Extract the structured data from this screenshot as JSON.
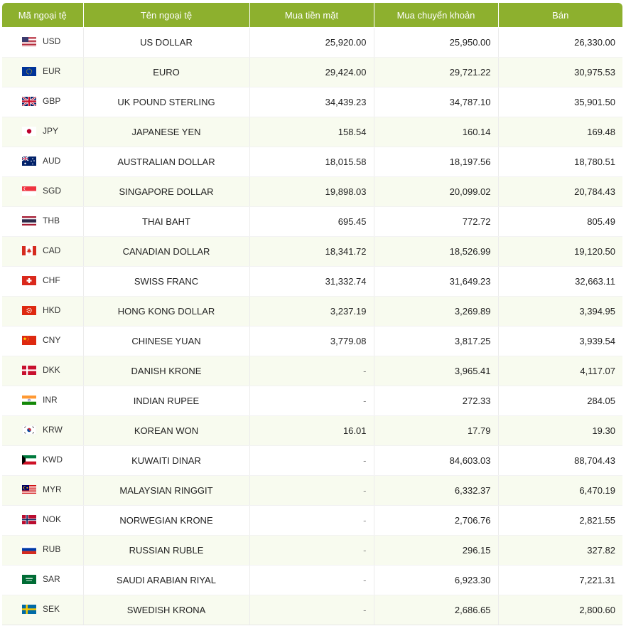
{
  "table": {
    "headers": {
      "code": "Mã ngoại tệ",
      "name": "Tên ngoại tệ",
      "cash_buy": "Mua tiền mặt",
      "transfer_buy": "Mua chuyển khoản",
      "sell": "Bán"
    },
    "rows": [
      {
        "code": "USD",
        "name": "US DOLLAR",
        "cash_buy": "25,920.00",
        "transfer_buy": "25,950.00",
        "sell": "26,330.00",
        "flag": "us-flag-icon"
      },
      {
        "code": "EUR",
        "name": "EURO",
        "cash_buy": "29,424.00",
        "transfer_buy": "29,721.22",
        "sell": "30,975.53",
        "flag": "eu-flag-icon"
      },
      {
        "code": "GBP",
        "name": "UK POUND STERLING",
        "cash_buy": "34,439.23",
        "transfer_buy": "34,787.10",
        "sell": "35,901.50",
        "flag": "uk-flag-icon"
      },
      {
        "code": "JPY",
        "name": "JAPANESE YEN",
        "cash_buy": "158.54",
        "transfer_buy": "160.14",
        "sell": "169.48",
        "flag": "japan-flag-icon"
      },
      {
        "code": "AUD",
        "name": "AUSTRALIAN DOLLAR",
        "cash_buy": "18,015.58",
        "transfer_buy": "18,197.56",
        "sell": "18,780.51",
        "flag": "australia-flag-icon"
      },
      {
        "code": "SGD",
        "name": "SINGAPORE DOLLAR",
        "cash_buy": "19,898.03",
        "transfer_buy": "20,099.02",
        "sell": "20,784.43",
        "flag": "singapore-flag-icon"
      },
      {
        "code": "THB",
        "name": "THAI BAHT",
        "cash_buy": "695.45",
        "transfer_buy": "772.72",
        "sell": "805.49",
        "flag": "thailand-flag-icon"
      },
      {
        "code": "CAD",
        "name": "CANADIAN DOLLAR",
        "cash_buy": "18,341.72",
        "transfer_buy": "18,526.99",
        "sell": "19,120.50",
        "flag": "canada-flag-icon"
      },
      {
        "code": "CHF",
        "name": "SWISS FRANC",
        "cash_buy": "31,332.74",
        "transfer_buy": "31,649.23",
        "sell": "32,663.11",
        "flag": "switzerland-flag-icon"
      },
      {
        "code": "HKD",
        "name": "HONG KONG DOLLAR",
        "cash_buy": "3,237.19",
        "transfer_buy": "3,269.89",
        "sell": "3,394.95",
        "flag": "hong-kong-flag-icon"
      },
      {
        "code": "CNY",
        "name": "CHINESE YUAN",
        "cash_buy": "3,779.08",
        "transfer_buy": "3,817.25",
        "sell": "3,939.54",
        "flag": "china-flag-icon"
      },
      {
        "code": "DKK",
        "name": "DANISH KRONE",
        "cash_buy": "-",
        "transfer_buy": "3,965.41",
        "sell": "4,117.07",
        "flag": "denmark-flag-icon"
      },
      {
        "code": "INR",
        "name": "INDIAN RUPEE",
        "cash_buy": "-",
        "transfer_buy": "272.33",
        "sell": "284.05",
        "flag": "india-flag-icon"
      },
      {
        "code": "KRW",
        "name": "KOREAN WON",
        "cash_buy": "16.01",
        "transfer_buy": "17.79",
        "sell": "19.30",
        "flag": "korea-flag-icon"
      },
      {
        "code": "KWD",
        "name": "KUWAITI DINAR",
        "cash_buy": "-",
        "transfer_buy": "84,603.03",
        "sell": "88,704.43",
        "flag": "kuwait-flag-icon"
      },
      {
        "code": "MYR",
        "name": "MALAYSIAN RINGGIT",
        "cash_buy": "-",
        "transfer_buy": "6,332.37",
        "sell": "6,470.19",
        "flag": "malaysia-flag-icon"
      },
      {
        "code": "NOK",
        "name": "NORWEGIAN KRONE",
        "cash_buy": "-",
        "transfer_buy": "2,706.76",
        "sell": "2,821.55",
        "flag": "norway-flag-icon"
      },
      {
        "code": "RUB",
        "name": "RUSSIAN RUBLE",
        "cash_buy": "-",
        "transfer_buy": "296.15",
        "sell": "327.82",
        "flag": "russia-flag-icon"
      },
      {
        "code": "SAR",
        "name": "SAUDI ARABIAN RIYAL",
        "cash_buy": "-",
        "transfer_buy": "6,923.30",
        "sell": "7,221.31",
        "flag": "saudi-arabia-flag-icon"
      },
      {
        "code": "SEK",
        "name": "SWEDISH KRONA",
        "cash_buy": "-",
        "transfer_buy": "2,686.65",
        "sell": "2,800.60",
        "flag": "sweden-flag-icon"
      }
    ]
  },
  "colors": {
    "header_bg": "#8db02e",
    "zebra_row": "#f8fbef",
    "text": "#222222"
  }
}
